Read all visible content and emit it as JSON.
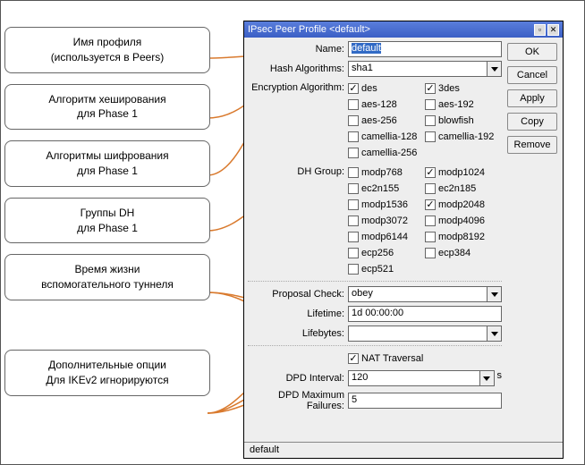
{
  "window": {
    "title": "IPsec Peer Profile <default>",
    "status": "default"
  },
  "buttons": {
    "ok": "OK",
    "cancel": "Cancel",
    "apply": "Apply",
    "copy": "Copy",
    "remove": "Remove"
  },
  "labels": {
    "name": "Name:",
    "hash": "Hash Algorithms:",
    "enc": "Encryption Algorithm:",
    "dh": "DH Group:",
    "proposal": "Proposal Check:",
    "lifetime": "Lifetime:",
    "lifebytes": "Lifebytes:",
    "nat": "NAT Traversal",
    "dpdint": "DPD Interval:",
    "dpdmax": "DPD Maximum Failures:",
    "dpdunit": "s"
  },
  "values": {
    "name": "default",
    "hash": "sha1",
    "proposal": "obey",
    "lifetime": "1d 00:00:00",
    "lifebytes": "",
    "dpdint": "120",
    "dpdmax": "5",
    "nat": true
  },
  "enc": [
    {
      "label": "des",
      "checked": true
    },
    {
      "label": "3des",
      "checked": true
    },
    {
      "label": "aes-128",
      "checked": false
    },
    {
      "label": "aes-192",
      "checked": false
    },
    {
      "label": "aes-256",
      "checked": false
    },
    {
      "label": "blowfish",
      "checked": false
    },
    {
      "label": "camellia-128",
      "checked": false
    },
    {
      "label": "camellia-192",
      "checked": false
    },
    {
      "label": "camellia-256",
      "checked": false
    }
  ],
  "dh": [
    {
      "label": "modp768",
      "checked": false
    },
    {
      "label": "modp1024",
      "checked": true
    },
    {
      "label": "ec2n155",
      "checked": false
    },
    {
      "label": "ec2n185",
      "checked": false
    },
    {
      "label": "modp1536",
      "checked": false
    },
    {
      "label": "modp2048",
      "checked": true
    },
    {
      "label": "modp3072",
      "checked": false
    },
    {
      "label": "modp4096",
      "checked": false
    },
    {
      "label": "modp6144",
      "checked": false
    },
    {
      "label": "modp8192",
      "checked": false
    },
    {
      "label": "ecp256",
      "checked": false
    },
    {
      "label": "ecp384",
      "checked": false
    },
    {
      "label": "ecp521",
      "checked": false
    }
  ],
  "callouts": {
    "c1": "Имя профиля\n(используется в Peers)",
    "c2": "Алгоритм хеширования\nдля Phase 1",
    "c3": "Алгоритмы шифрования\nдля Phase 1",
    "c4": "Группы DH\nдля Phase 1",
    "c5": "Время жизни\nвспомогательного туннеля",
    "c6": "Дополнительные опции\nДля IKEv2 игнорируются"
  }
}
